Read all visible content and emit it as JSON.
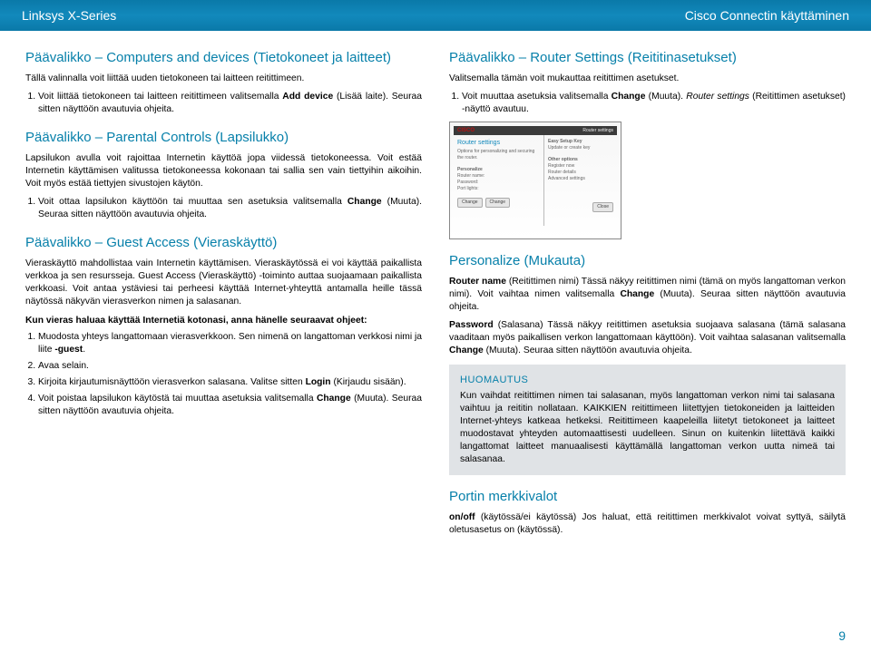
{
  "header": {
    "left": "Linksys X-Series",
    "right": "Cisco Connectin käyttäminen"
  },
  "left_col": {
    "s1_title": "Päävalikko – Computers and devices (Tietokoneet ja laitteet)",
    "s1_intro": "Tällä valinnalla voit liittää uuden tietokoneen tai laitteen reitittimeen.",
    "s1_li1_pre": "Voit liittää tietokoneen tai laitteen reitittimeen valitsemalla ",
    "s1_li1_b": "Add device",
    "s1_li1_post": " (Lisää laite). Seuraa sitten näyttöön avautuvia ohjeita.",
    "s2_title": "Päävalikko – Parental Controls (Lapsilukko)",
    "s2_p1": "Lapsilukon avulla voit rajoittaa Internetin käyttöä jopa viidessä tietokoneessa. Voit estää Internetin käyttämisen valitussa tietokoneessa kokonaan tai sallia sen vain tiettyihin aikoihin. Voit myös estää tiettyjen sivustojen käytön.",
    "s2_li1_pre": "Voit ottaa lapsilukon käyttöön tai muuttaa sen asetuksia valitsemalla ",
    "s2_li1_b": "Change",
    "s2_li1_post": " (Muuta). Seuraa sitten näyttöön avautuvia ohjeita.",
    "s3_title": "Päävalikko – Guest Access (Vieraskäyttö)",
    "s3_p1": "Vieraskäyttö mahdollistaa vain Internetin käyttämisen. Vieraskäytössä ei voi käyttää paikallista verkkoa ja sen resursseja. Guest Access (Vieraskäyttö) -toiminto auttaa suojaamaan paikallista verkkoasi. Voit antaa ystäviesi tai perheesi käyttää Internet-yhteyttä antamalla heille tässä näytössä näkyvän vierasverkon nimen ja salasanan.",
    "s3_sub": "Kun vieras haluaa käyttää Internetiä kotonasi, anna hänelle seuraavat ohjeet:",
    "s3_li1_pre": "Muodosta yhteys langattomaan vierasverkkoon. Sen nimenä on langattoman verkkosi nimi ja liite ",
    "s3_li1_b": "-guest",
    "s3_li1_post": ".",
    "s3_li2": "Avaa selain.",
    "s3_li3_pre": "Kirjoita kirjautumisnäyttöön vierasverkon salasana. Valitse sitten ",
    "s3_li3_b": "Login",
    "s3_li3_post": " (Kirjaudu sisään).",
    "s3_li4_pre": "Voit poistaa lapsilukon käytöstä tai muuttaa asetuksia valitsemalla ",
    "s3_li4_b": "Change",
    "s3_li4_post": " (Muuta). Seuraa sitten näyttöön avautuvia ohjeita."
  },
  "right_col": {
    "s1_title": "Päävalikko – Router Settings (Reititinasetukset)",
    "s1_intro": "Valitsemalla tämän voit mukauttaa reitittimen asetukset.",
    "s1_li1_pre": "Voit muuttaa asetuksia valitsemalla ",
    "s1_li1_b": "Change",
    "s1_li1_mid": " (Muuta). ",
    "s1_li1_i": "Router settings",
    "s1_li1_post": " (Reitittimen asetukset) -näyttö avautuu.",
    "img": {
      "brand": "CISCO",
      "menu": "Router settings",
      "title": "Router settings",
      "desc": "Options for personalizing and securing the router.",
      "pers": "Personalize",
      "rname": "Router name:",
      "pwd": "Password:",
      "plight": "Port lights:",
      "easy": "Easy Setup Key",
      "update": "Update or create key",
      "other": "Other options",
      "reg": "Register now",
      "det": "Router details",
      "adv": "Advanced settings",
      "btn1": "Change",
      "btn2": "Change",
      "btn_close": "Close"
    },
    "s2_title": "Personalize (Mukauta)",
    "s2_p1_b1": "Router name",
    "s2_p1_mid1": " (Reitittimen nimi) Tässä näkyy reitittimen nimi (tämä on myös langattoman verkon nimi). Voit vaihtaa nimen valitsemalla ",
    "s2_p1_b2": "Change",
    "s2_p1_post": " (Muuta). Seuraa sitten näyttöön avautuvia ohjeita.",
    "s2_p2_b1": "Password",
    "s2_p2_mid1": " (Salasana) Tässä näkyy reitittimen asetuksia suojaava salasana (tämä salasana vaaditaan myös paikallisen verkon langattomaan käyttöön). Voit vaihtaa salasanan valitsemalla ",
    "s2_p2_b2": "Change",
    "s2_p2_post": " (Muuta). Seuraa sitten näyttöön avautuvia ohjeita.",
    "notice_title": "HUOMAUTUS",
    "notice_body": "Kun vaihdat reitittimen nimen tai salasanan, myös langattoman verkon nimi tai salasana vaihtuu ja reititin nollataan. KAIKKIEN reitittimeen liitettyjen tietokoneiden ja laitteiden Internet-yhteys katkeaa hetkeksi. Reitittimeen kaapeleilla liitetyt tietokoneet ja laitteet muodostavat yhteyden automaattisesti uudelleen. Sinun on kuitenkin liitettävä kaikki langattomat laitteet manuaalisesti käyttämällä langattoman verkon uutta nimeä tai salasanaa.",
    "s3_title": "Portin merkkivalot",
    "s3_p_b": "on/off",
    "s3_p_post": " (käytössä/ei käytössä) Jos haluat, että reitittimen merkkivalot voivat syttyä, säilytä oletusasetus on (käytössä)."
  },
  "pagenum": "9"
}
